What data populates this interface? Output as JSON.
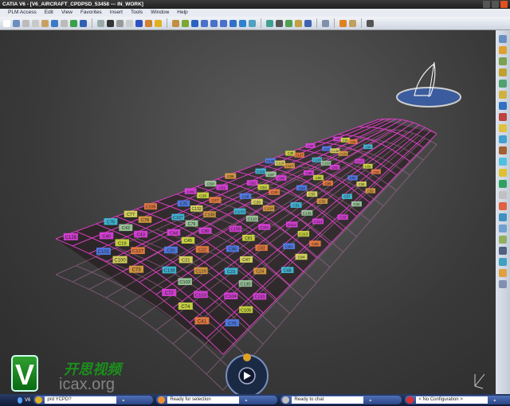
{
  "window": {
    "title": "CATIA V6 - [V6_AIRCRAFT_CPDPSD_53458 --- IN_WORK]"
  },
  "menu": [
    "PLM Access",
    "Edit",
    "View",
    "Favorites",
    "Insert",
    "Tools",
    "Window",
    "Help"
  ],
  "toolbar_icons": [
    "new-icon",
    "open-icon",
    "cut-icon",
    "copy-icon",
    "paste-icon",
    "undo-icon",
    "redo-icon",
    "globe-icon",
    "help-icon",
    "sketch-icon",
    "formula-icon",
    "catalog-icon",
    "light-icon",
    "filter-icon",
    "branch-icon",
    "lock-icon",
    "cube-icon",
    "fit-all-icon",
    "pan-icon",
    "rotate-icon",
    "zoom-in-icon",
    "zoom-out-icon",
    "normal-view-icon",
    "iso-view-icon",
    "multi-view-icon",
    "render-icon",
    "hide-show-icon",
    "swap-icon",
    "material-icon",
    "apply-material-icon",
    "sphere-icon",
    "measure-icon",
    "table-icon",
    "camera-icon"
  ],
  "toolbar_colors": [
    "#ffffff",
    "#6a8fbf",
    "#bbbbbb",
    "#c8c8c8",
    "#caa060",
    "#3a7ac8",
    "#bbbbbb",
    "#38a048",
    "#3060b0",
    "#9aa",
    "#333",
    "#999",
    "#ccc",
    "#3050c0",
    "#d08030",
    "#e0b020",
    "#c09040",
    "#7aa830",
    "#2a60c0",
    "#4a70c8",
    "#4a70c8",
    "#4a70c8",
    "#3070c8",
    "#3080d0",
    "#50a0c0",
    "#40a090",
    "#555",
    "#50a050",
    "#c0a040",
    "#4060b0",
    "#8090a8",
    "#e08020",
    "#c0a060",
    "#555"
  ],
  "scene": {
    "labels": [
      "C126",
      "C101",
      "C100",
      "C73",
      "C72",
      "C74",
      "C41",
      "C40",
      "C19",
      "C127",
      "C128",
      "C102",
      "C103",
      "C75",
      "C76",
      "C42",
      "C43",
      "C20",
      "C21",
      "C129",
      "C104",
      "C105",
      "C77",
      "C78",
      "C44",
      "C45",
      "C22",
      "C23",
      "C130",
      "C131",
      "C106",
      "C107",
      "C79",
      "C80",
      "C46",
      "C47",
      "C24",
      "C25",
      "C132",
      "C108",
      "C109",
      "C81",
      "C82",
      "C48",
      "C49",
      "C26",
      "C27",
      "C133",
      "C110",
      "C111",
      "C83",
      "C84",
      "C50",
      "C51",
      "C28",
      "C29",
      "C134",
      "C112",
      "C113",
      "C85",
      "C86",
      "C52",
      "C53",
      "C30",
      "C31",
      "C135",
      "C114",
      "C115",
      "C87",
      "C88",
      "C54",
      "C55",
      "C32",
      "C33",
      "C136",
      "C116",
      "C117",
      "C89",
      "C90",
      "C56",
      "C57",
      "C34",
      "C35",
      "C137",
      "C118",
      "C119",
      "C91",
      "C92",
      "C58",
      "C59",
      "C36",
      "C37",
      "C138",
      "C120",
      "C121",
      "C93",
      "C94",
      "C60",
      "C61",
      "C38",
      "C39"
    ],
    "label_colors": [
      "#e040e0",
      "#f0d040",
      "#40c0e0",
      "#e0e060",
      "#f08040",
      "#90d040",
      "#e040e0",
      "#a0d0a0",
      "#e0a040",
      "#f06090",
      "#5080f0",
      "#d0e040"
    ],
    "mesh_color": "#e040c8"
  },
  "right_toolbar_icons": [
    "wireframe-icon",
    "select-icon",
    "sketcher-icon",
    "pad-icon",
    "surface-icon",
    "extrude-icon",
    "revolve-icon",
    "sweep-icon",
    "fill-icon",
    "blend-icon",
    "join-icon",
    "split-icon",
    "trim-icon",
    "offset-icon",
    "fillet-icon",
    "translate-icon",
    "rotate-icon",
    "symmetry-icon",
    "scale-icon",
    "pattern-icon",
    "analysis-icon",
    "law-icon",
    "measure-icon"
  ],
  "watermark": {
    "logo": "V",
    "cn": "开思视频",
    "site": "icax.org"
  },
  "taskbar": {
    "start": "V6",
    "tasks": [
      {
        "text": "prd YCPD?",
        "icon_color": "#e0b020"
      },
      {
        "text": "Ready for selection",
        "icon_color": "#f09030"
      },
      {
        "text": "Ready to chat",
        "icon_color": "#c0c0c0"
      },
      {
        "text": "< No Configuration >",
        "icon_color": "#e03030"
      }
    ]
  }
}
